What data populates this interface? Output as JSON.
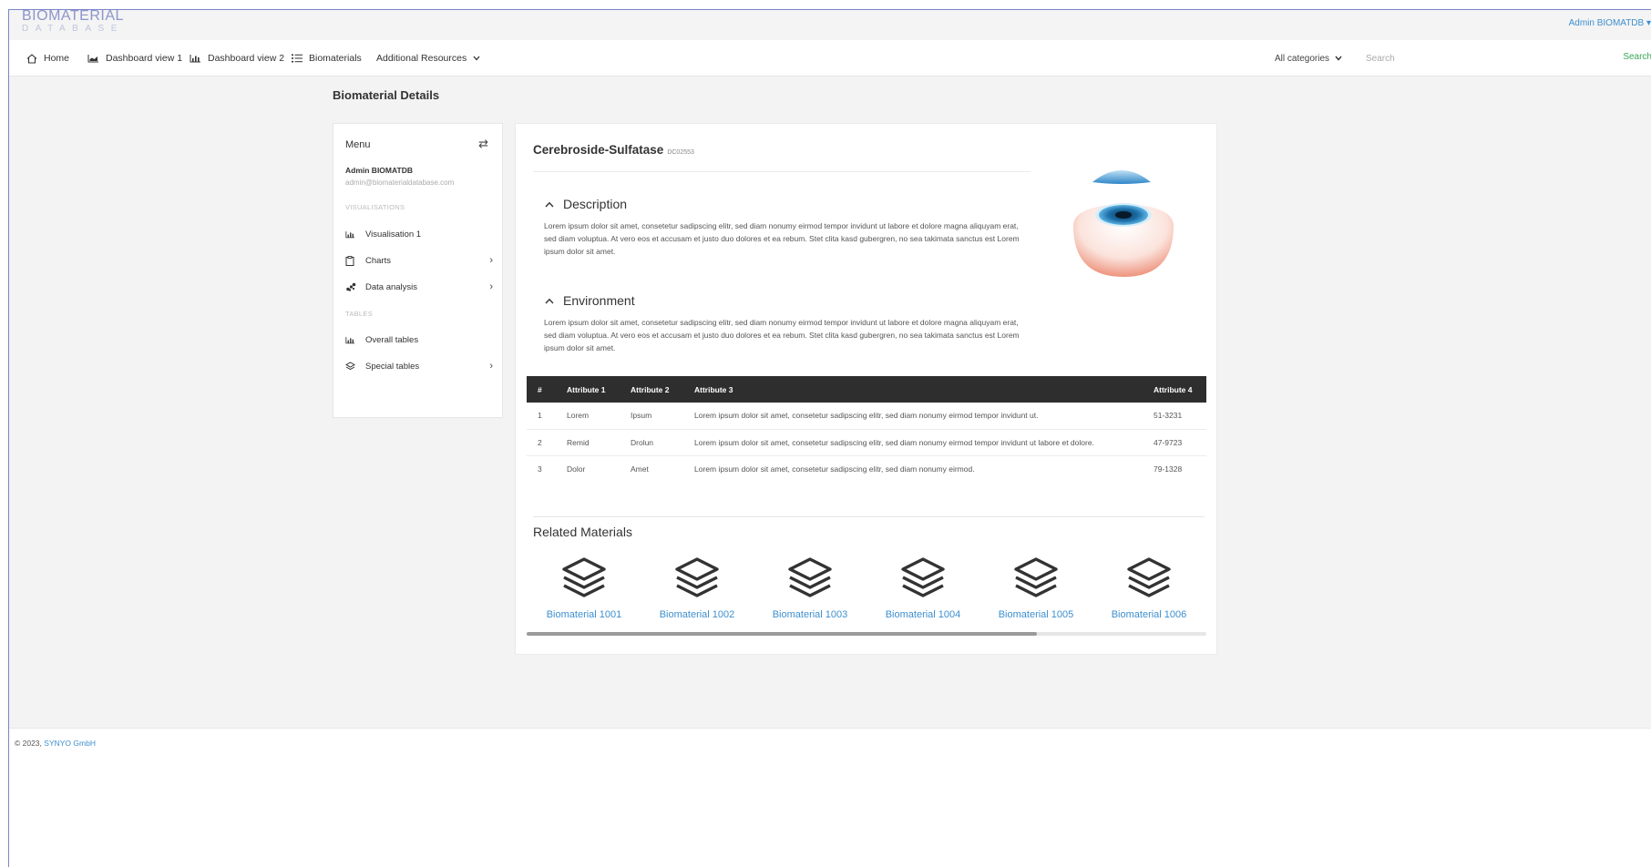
{
  "brand": {
    "title": "BIOMATERIAL",
    "subtitle": "DATABASE"
  },
  "user_menu": {
    "label": "Admin BIOMATDB ▾"
  },
  "nav": {
    "items": [
      {
        "label": "Home",
        "icon": "home-icon"
      },
      {
        "label": "Dashboard view 1",
        "icon": "area-chart-icon"
      },
      {
        "label": "Dashboard view 2",
        "icon": "bar-chart-icon"
      },
      {
        "label": "Biomaterials",
        "icon": "list-icon"
      },
      {
        "label": "Additional Resources",
        "icon": "chevron-down-icon"
      }
    ],
    "category_select": "All categories",
    "search_placeholder": "Search",
    "search_button": "Search"
  },
  "page_title": "Biomaterial Details",
  "menu": {
    "title": "Menu",
    "toggle_icon": "swap-icon",
    "user_name": "Admin BIOMATDB",
    "user_email": "admin@biomaterialdatabase.com",
    "section_visualisations": "VISUALISATIONS",
    "section_tables": "TABLES",
    "items": [
      {
        "label": "Visualisation 1",
        "icon": "bar-chart-icon",
        "has_submenu": false
      },
      {
        "label": "Charts",
        "icon": "clipboard-icon",
        "has_submenu": true
      },
      {
        "label": "Data analysis",
        "icon": "scatter-icon",
        "has_submenu": true
      },
      {
        "label": "Overall tables",
        "icon": "bar-chart-icon",
        "has_submenu": false
      },
      {
        "label": "Special tables",
        "icon": "layers-icon",
        "has_submenu": true
      }
    ]
  },
  "material": {
    "name": "Cerebroside-Sulfatase",
    "code": "DC02553",
    "description_title": "Description",
    "description_text": "Lorem ipsum dolor sit amet, consetetur sadipscing elitr, sed diam nonumy eirmod tempor invidunt ut labore et dolore magna aliquyam erat, sed diam voluptua. At vero eos et accusam et justo duo dolores et ea rebum. Stet clita kasd gubergren, no sea takimata sanctus est Lorem ipsum dolor sit amet.",
    "environment_title": "Environment",
    "environment_text": "Lorem ipsum dolor sit amet, consetetur sadipscing elitr, sed diam nonumy eirmod tempor invidunt ut labore et dolore magna aliquyam erat, sed diam voluptua. At vero eos et accusam et justo duo dolores et ea rebum. Stet clita kasd gubergren, no sea takimata sanctus est Lorem ipsum dolor sit amet."
  },
  "table": {
    "headers": [
      "#",
      "Attribute 1",
      "Attribute 2",
      "Attribute 3",
      "Attribute 4"
    ],
    "rows": [
      [
        "1",
        "Lorem",
        "Ipsum",
        "Lorem ipsum dolor sit amet, consetetur sadipscing elitr, sed diam nonumy eirmod tempor invidunt ut.",
        "51-3231"
      ],
      [
        "2",
        "Remid",
        "Drolun",
        "Lorem ipsum dolor sit amet, consetetur sadipscing elitr, sed diam nonumy eirmod tempor invidunt ut labore et dolore.",
        "47-9723"
      ],
      [
        "3",
        "Dolor",
        "Amet",
        "Lorem ipsum dolor sit amet, consetetur sadipscing elitr, sed diam nonumy eirmod.",
        "79-1328"
      ]
    ]
  },
  "related": {
    "title": "Related Materials",
    "items": [
      {
        "label": "Biomaterial 1001"
      },
      {
        "label": "Biomaterial 1002"
      },
      {
        "label": "Biomaterial 1003"
      },
      {
        "label": "Biomaterial 1004"
      },
      {
        "label": "Biomaterial 1005"
      },
      {
        "label": "Biomaterial 1006"
      }
    ]
  },
  "footer": {
    "copyright": "© 2023,",
    "company": "SYNYO GmbH"
  },
  "colors": {
    "accent": "#3d8fcf",
    "brand": "#8d95cc",
    "table_header": "#2e2e2e",
    "search_button": "#3aa857"
  }
}
